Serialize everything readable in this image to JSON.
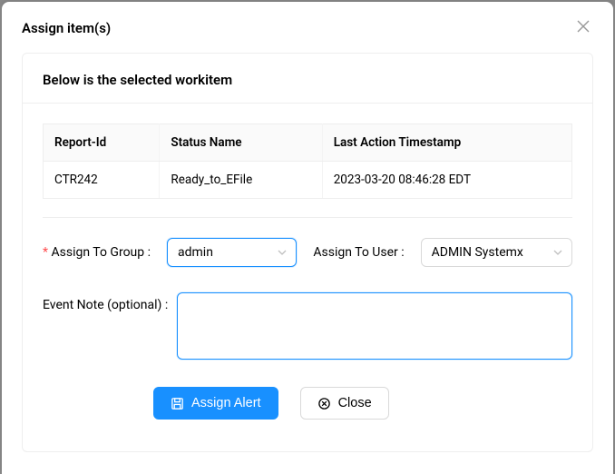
{
  "modal": {
    "title": "Assign item(s)",
    "subtitle": "Below is the selected workitem"
  },
  "table": {
    "headers": [
      "Report-Id",
      "Status Name",
      "Last Action Timestamp"
    ],
    "row": {
      "report_id": "CTR242",
      "status_name": "Ready_to_EFile",
      "timestamp": "2023-03-20 08:46:28 EDT"
    }
  },
  "form": {
    "assign_group_label": "Assign To Group :",
    "assign_group_value": "admin",
    "assign_user_label": "Assign To User :",
    "assign_user_value": "ADMIN Systemx",
    "event_note_label": "Event Note (optional) :",
    "event_note_value": ""
  },
  "buttons": {
    "assign": "Assign Alert",
    "close": "Close"
  }
}
